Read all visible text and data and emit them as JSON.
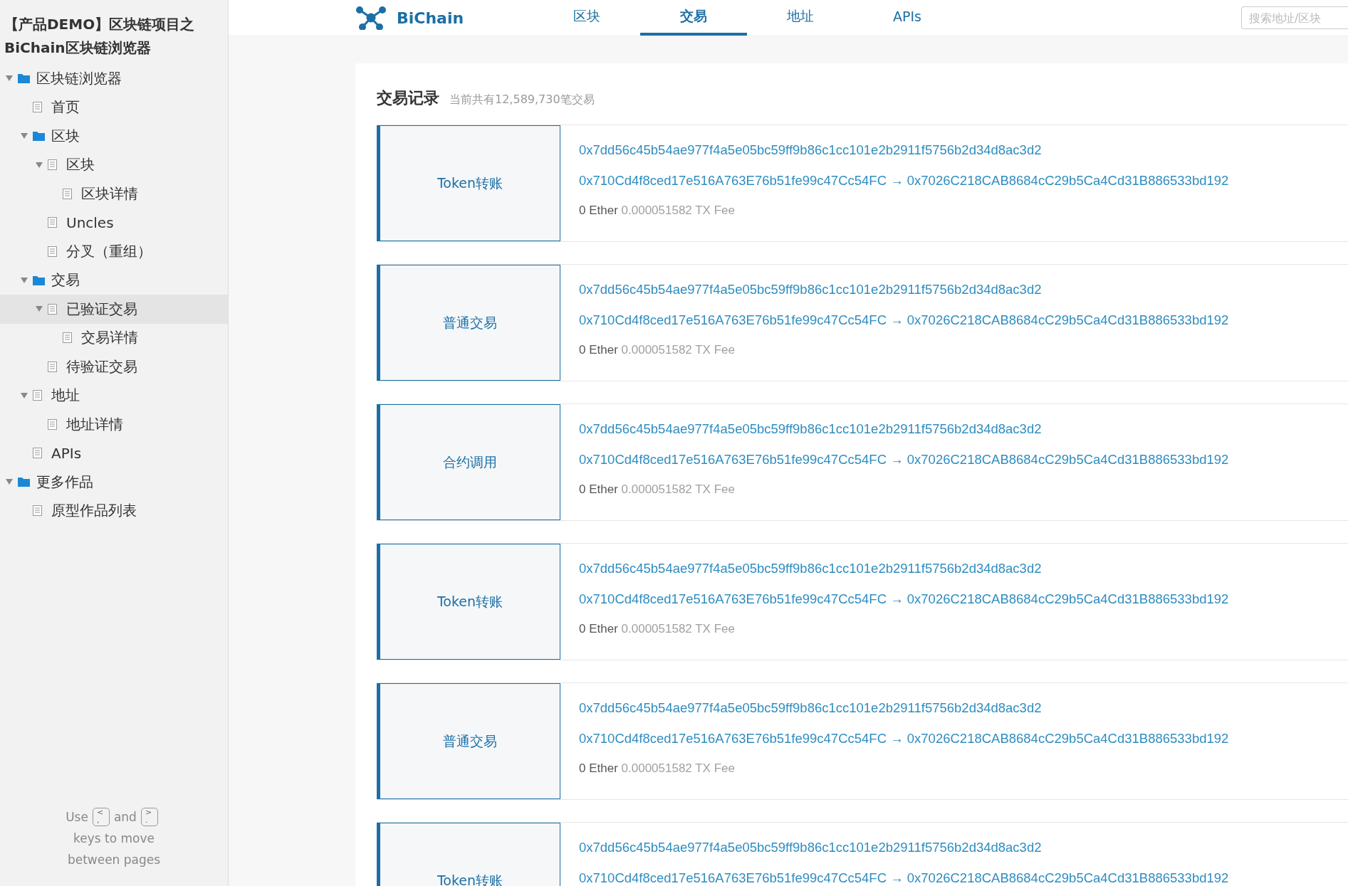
{
  "sidebar": {
    "title_lines": [
      "【产品DEMO】区块链项目之",
      "BiChain区块链浏览器"
    ],
    "tree": [
      {
        "label": "区块链浏览器",
        "kind": "folder",
        "selected": false,
        "expanded": true,
        "children": [
          {
            "label": "首页",
            "kind": "page",
            "selected": false
          },
          {
            "label": "区块",
            "kind": "folder",
            "selected": false,
            "expanded": true,
            "children": [
              {
                "label": "区块",
                "kind": "page",
                "selected": false,
                "expanded": true,
                "children": [
                  {
                    "label": "区块详情",
                    "kind": "page",
                    "selected": false
                  }
                ]
              },
              {
                "label": "Uncles",
                "kind": "page",
                "selected": false
              },
              {
                "label": "分叉（重组）",
                "kind": "page",
                "selected": false
              }
            ]
          },
          {
            "label": "交易",
            "kind": "folder",
            "selected": false,
            "expanded": true,
            "children": [
              {
                "label": "已验证交易",
                "kind": "page",
                "selected": true,
                "expanded": true,
                "children": [
                  {
                    "label": "交易详情",
                    "kind": "page",
                    "selected": false
                  }
                ]
              },
              {
                "label": "待验证交易",
                "kind": "page",
                "selected": false
              }
            ]
          },
          {
            "label": "地址",
            "kind": "page",
            "selected": false,
            "expanded": true,
            "children": [
              {
                "label": "地址详情",
                "kind": "page",
                "selected": false
              }
            ]
          },
          {
            "label": "APIs",
            "kind": "page",
            "selected": false
          }
        ]
      },
      {
        "label": "更多作品",
        "kind": "folder",
        "selected": false,
        "expanded": true,
        "children": [
          {
            "label": "原型作品列表",
            "kind": "page",
            "selected": false
          }
        ]
      }
    ],
    "hint": {
      "use": "Use",
      "prev_key": [
        "<",
        ","
      ],
      "and": "and",
      "next_key": [
        ">",
        "."
      ],
      "rest": "keys to move between pages"
    }
  },
  "header": {
    "logo": "BiChain",
    "tabs": [
      {
        "label": "区块",
        "selected": false
      },
      {
        "label": "交易",
        "selected": true
      },
      {
        "label": "地址",
        "selected": false
      },
      {
        "label": "APIs",
        "selected": false
      }
    ],
    "search": {
      "placeholder": "搜索地址/区块"
    }
  },
  "panel": {
    "title": "交易记录",
    "subtitle": "当前共有12,589,730笔交易",
    "transactions": [
      {
        "type": "Token转账",
        "hash": "0x7dd56c45b54ae977f4a5e05bc59ff9b86c1cc101e2b2911f5756b2d34d8ac3d2",
        "from": "0x710Cd4f8ced17e516A763E76b51fe99c47Cc54FC",
        "arrow": "→",
        "to": "0x7026C218CAB8684cC29b5Ca4Cd31B886533bd192",
        "amount": "0 Ether",
        "fee": "0.000051582 TX Fee"
      },
      {
        "type": "普通交易",
        "hash": "0x7dd56c45b54ae977f4a5e05bc59ff9b86c1cc101e2b2911f5756b2d34d8ac3d2",
        "from": "0x710Cd4f8ced17e516A763E76b51fe99c47Cc54FC",
        "arrow": "→",
        "to": "0x7026C218CAB8684cC29b5Ca4Cd31B886533bd192",
        "amount": "0 Ether",
        "fee": "0.000051582 TX Fee"
      },
      {
        "type": "合约调用",
        "hash": "0x7dd56c45b54ae977f4a5e05bc59ff9b86c1cc101e2b2911f5756b2d34d8ac3d2",
        "from": "0x710Cd4f8ced17e516A763E76b51fe99c47Cc54FC",
        "arrow": "→",
        "to": "0x7026C218CAB8684cC29b5Ca4Cd31B886533bd192",
        "amount": "0 Ether",
        "fee": "0.000051582 TX Fee"
      },
      {
        "type": "Token转账",
        "hash": "0x7dd56c45b54ae977f4a5e05bc59ff9b86c1cc101e2b2911f5756b2d34d8ac3d2",
        "from": "0x710Cd4f8ced17e516A763E76b51fe99c47Cc54FC",
        "arrow": "→",
        "to": "0x7026C218CAB8684cC29b5Ca4Cd31B886533bd192",
        "amount": "0 Ether",
        "fee": "0.000051582 TX Fee"
      },
      {
        "type": "普通交易",
        "hash": "0x7dd56c45b54ae977f4a5e05bc59ff9b86c1cc101e2b2911f5756b2d34d8ac3d2",
        "from": "0x710Cd4f8ced17e516A763E76b51fe99c47Cc54FC",
        "arrow": "→",
        "to": "0x7026C218CAB8684cC29b5Ca4Cd31B886533bd192",
        "amount": "0 Ether",
        "fee": "0.000051582 TX Fee"
      },
      {
        "type": "Token转账",
        "hash": "0x7dd56c45b54ae977f4a5e05bc59ff9b86c1cc101e2b2911f5756b2d34d8ac3d2",
        "from": "0x710Cd4f8ced17e516A763E76b51fe99c47Cc54FC",
        "arrow": "→",
        "to": "0x7026C218CAB8684cC29b5Ca4Cd31B886533bd192"
      }
    ]
  }
}
